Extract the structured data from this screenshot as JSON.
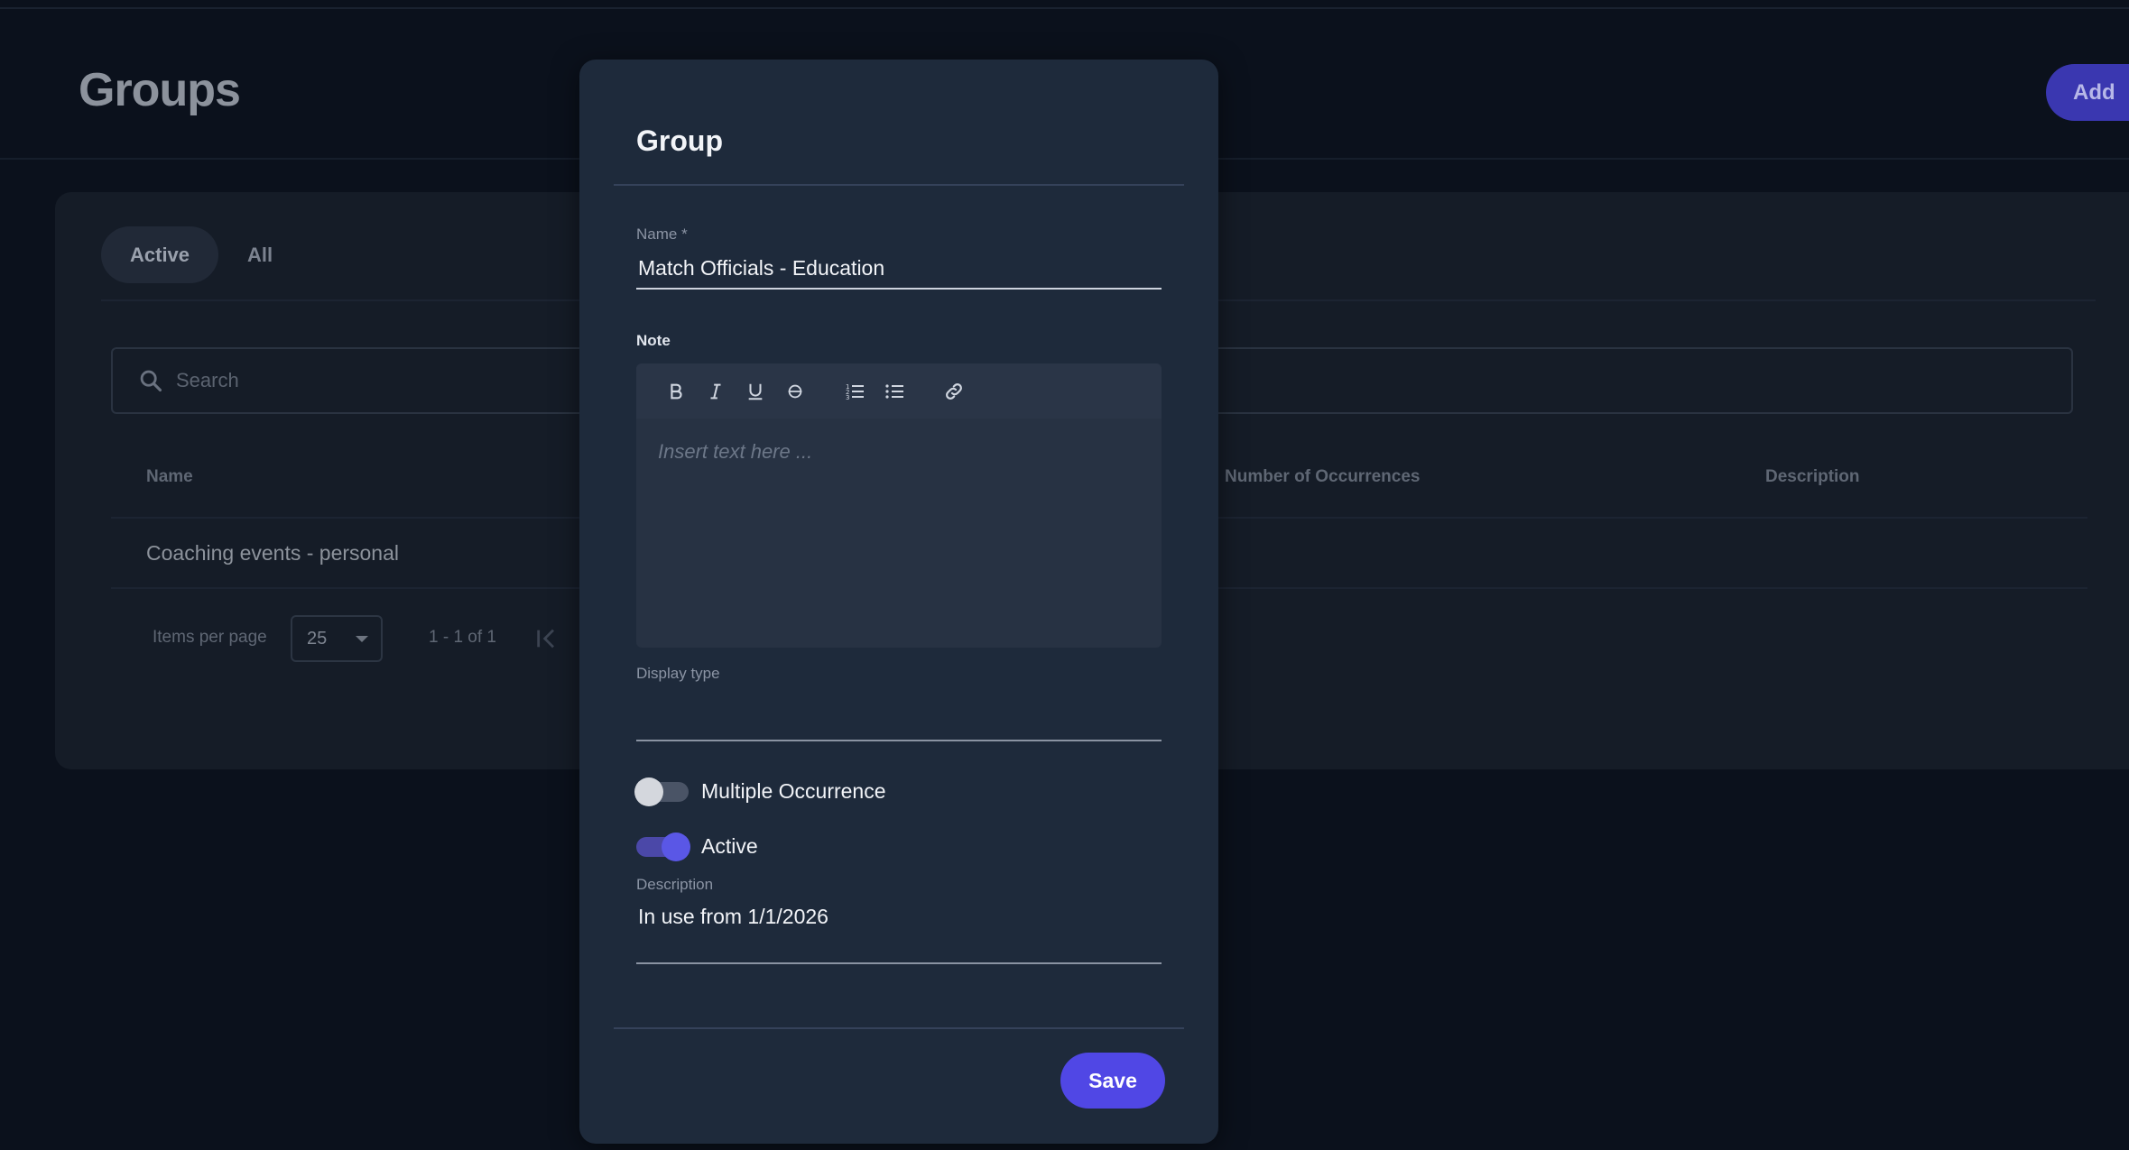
{
  "page": {
    "title": "Groups",
    "add_label": "Add"
  },
  "tabs": [
    {
      "label": "Active",
      "active": true
    },
    {
      "label": "All",
      "active": false
    }
  ],
  "search": {
    "placeholder": "Search",
    "icon": "search-icon"
  },
  "table": {
    "columns": [
      "Name",
      "Number of Occurrences",
      "Description"
    ],
    "rows": [
      {
        "name": "Coaching events - personal"
      }
    ]
  },
  "pagination": {
    "items_per_page_label": "Items per page",
    "items_per_page_value": "25",
    "range_label": "1 - 1 of 1"
  },
  "modal": {
    "title": "Group",
    "name_label": "Name *",
    "name_value": "Match Officials - Education",
    "note_label": "Note",
    "note_placeholder": "Insert text here ...",
    "toolbar_icons": [
      "bold-icon",
      "italic-icon",
      "underline-icon",
      "strikethrough-icon",
      "ordered-list-icon",
      "bullet-list-icon",
      "link-icon"
    ],
    "display_type_label": "Display type",
    "display_type_value": "",
    "multiple_occurrence_label": "Multiple Occurrence",
    "multiple_occurrence_on": false,
    "active_label": "Active",
    "active_on": true,
    "description_label": "Description",
    "description_value": "In use from 1/1/2026",
    "save_label": "Save"
  },
  "colors": {
    "accent": "#5047e5",
    "background": "#0b111c",
    "modal_bg": "#1e2a3b"
  }
}
